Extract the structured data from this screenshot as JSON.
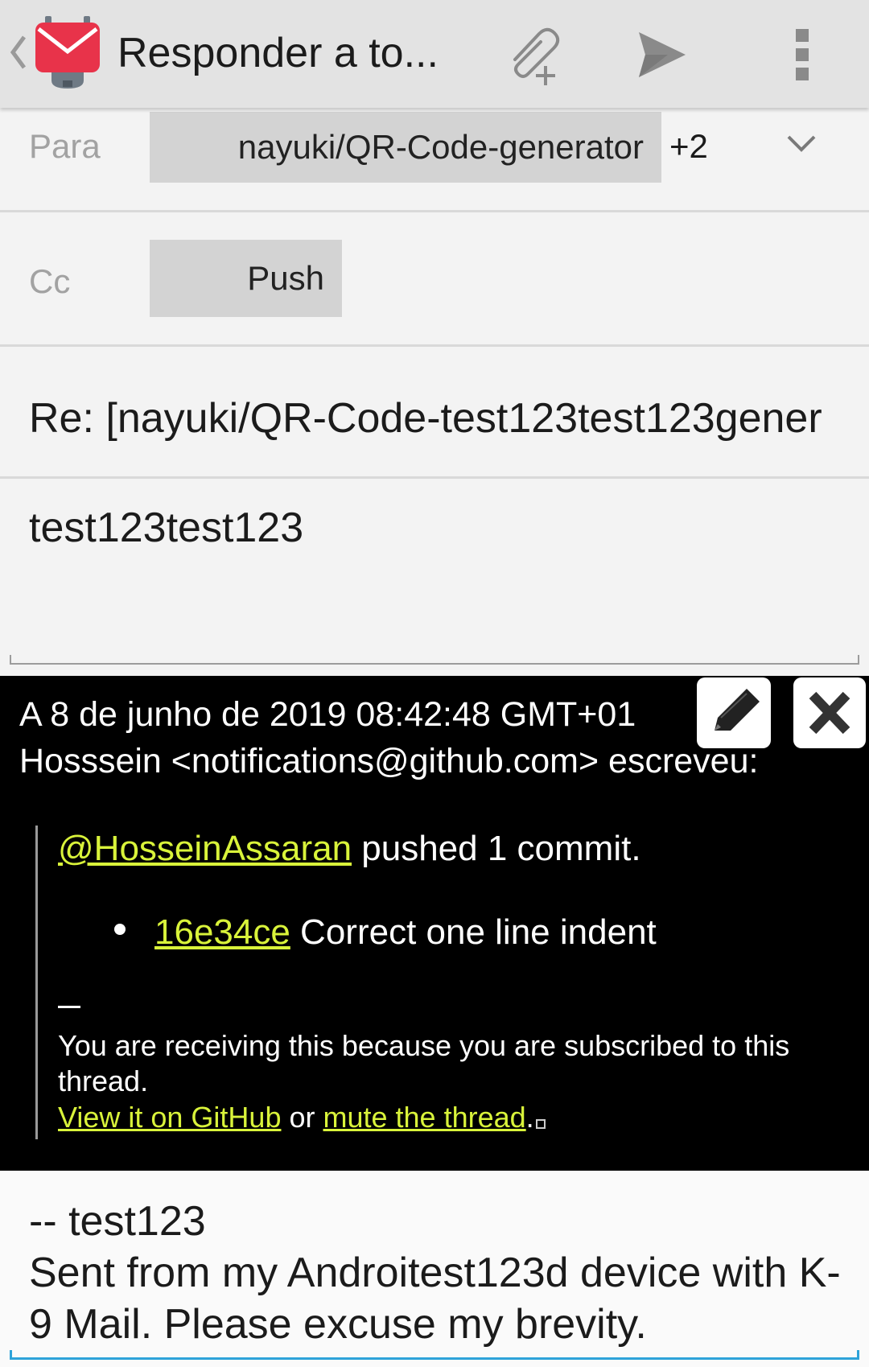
{
  "actionbar": {
    "title": "Responder a to...",
    "icons": [
      "up-caret-icon",
      "k9-mail-app-icon",
      "attach-file-icon",
      "send-icon",
      "overflow-menu-icon"
    ]
  },
  "to": {
    "label": "Para",
    "chip": "nayuki/QR-Code-generator",
    "more": "+2"
  },
  "cc": {
    "label": "Cc",
    "chip": "Push"
  },
  "subject": "Re: [nayuki/QR-Code-test123test123gener",
  "body": "test123test123",
  "quoted": {
    "header1": "A 8 de junho de 2019 08:42:48 GMT+01",
    "header2": "Hosssein <notifications@github.com> escreveu:",
    "mention": "@HosseinAssaran",
    "pushed": " pushed 1 commit.",
    "commit_hash": "16e34ce",
    "commit_msg": " Correct one line indent",
    "notice": "You are receiving this because you are subscribed to this thread.",
    "view_link": "View it on GitHub",
    "or": " or ",
    "mute_link": "mute the thread",
    "period": ".",
    "link_color": "#d9f33a"
  },
  "signature": {
    "line1": "-- test123",
    "line2": "Sent from my Androitest123d device with K-9 Mail. Please excuse my brevity."
  },
  "colors": {
    "accent": "#2ea3d9",
    "app_icon_red": "#e8334a",
    "chip_bg": "#d3d3d3"
  }
}
